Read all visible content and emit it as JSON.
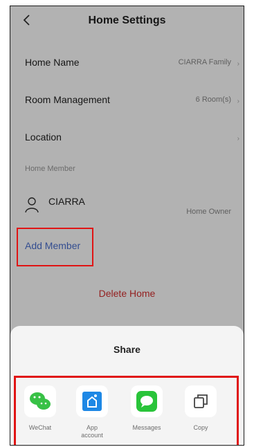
{
  "header": {
    "title": "Home Settings"
  },
  "settings": {
    "home_name": {
      "label": "Home Name",
      "value": "CIARRA Family"
    },
    "room_management": {
      "label": "Room Management",
      "value": "6 Room(s)"
    },
    "location": {
      "label": "Location",
      "value": ""
    }
  },
  "members": {
    "section_label": "Home Member",
    "items": [
      {
        "name": "CIARRA",
        "role": "Home Owner"
      }
    ],
    "add_label": "Add Member"
  },
  "delete_label": "Delete Home",
  "share": {
    "title": "Share",
    "items": [
      {
        "label": "WeChat",
        "icon": "wechat-icon",
        "color": "#38c146"
      },
      {
        "label": "App\naccount",
        "icon": "app-account-icon",
        "color": "#1e88e5"
      },
      {
        "label": "Messages",
        "icon": "messages-icon",
        "color": "#29c43a"
      },
      {
        "label": "Copy",
        "icon": "copy-icon",
        "color": "#444444"
      }
    ]
  },
  "colors": {
    "accent_link": "#4a6fcf",
    "danger": "#d43030",
    "highlight_border": "#e01414"
  }
}
